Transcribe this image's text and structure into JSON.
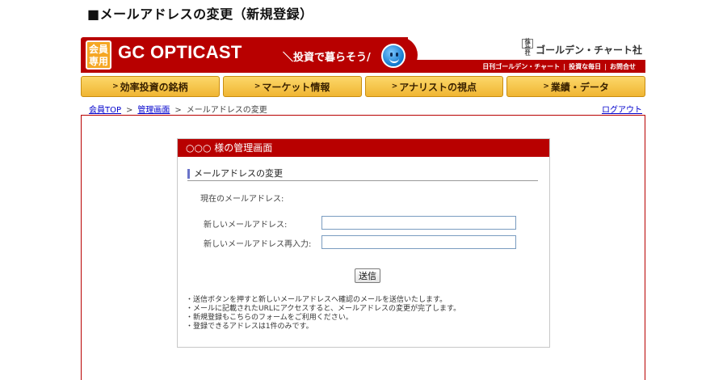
{
  "page_title": "■メールアドレスの変更（新規登録）",
  "header": {
    "member_badge_top": "会員",
    "member_badge_bottom": "専用",
    "logo_text": "GC OPTICAST",
    "slogan": "＼投資で暮らそう/",
    "company_mark": "株式会社",
    "company_name": "ゴールデン・チャート社",
    "links": [
      "日刊ゴールデン・チャート",
      "投資な毎日",
      "お問合せ"
    ]
  },
  "nav": {
    "items": [
      {
        "label": "効率投資の銘柄"
      },
      {
        "label": "マーケット情報"
      },
      {
        "label": "アナリストの視点"
      },
      {
        "label": "業績・データ"
      }
    ]
  },
  "breadcrumb": {
    "home": "会員TOP",
    "admin": "管理画面",
    "current": "メールアドレスの変更",
    "separator": ">",
    "logout": "ログアウト"
  },
  "panel": {
    "header": "○○○ 様の管理画面",
    "section_title": "メールアドレスの変更",
    "current_label": "現在のメールアドレス:",
    "current_value": "",
    "new_email_label": "新しいメールアドレス:",
    "new_email_value": "",
    "confirm_email_label": "新しいメールアドレス再入力:",
    "confirm_email_value": "",
    "submit_label": "送信",
    "notes": [
      "・送信ボタンを押すと新しいメールアドレスへ確認のメールを送信いたします。",
      "・メールに記載されたURLにアクセスすると、メールアドレスの変更が完了します。",
      "・新規登録もこちらのフォームをご利用ください。",
      "・登録できるアドレスは1件のみです。"
    ]
  },
  "colors": {
    "brand_red": "#b80000",
    "nav_gold": "#f0b532",
    "link_blue": "#0000cc"
  }
}
